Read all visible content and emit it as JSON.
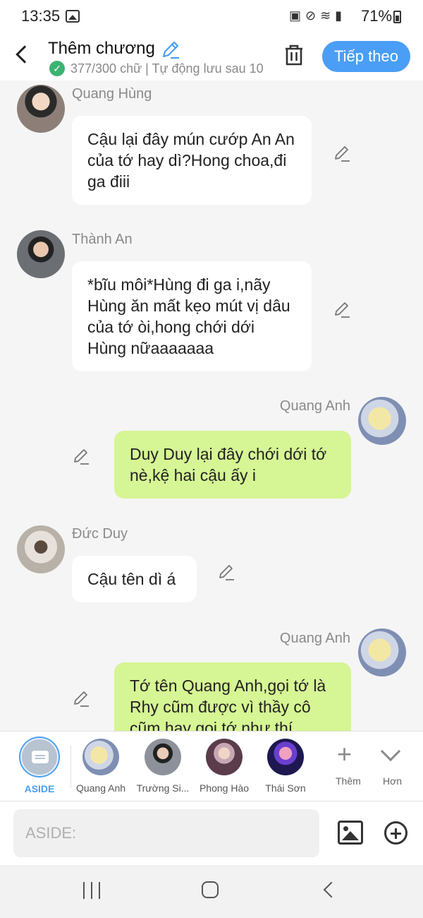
{
  "status_bar": {
    "time": "13:35",
    "battery": "71%"
  },
  "header": {
    "title": "Thêm chương",
    "subtitle": "377/300 chữ | Tự động lưu sau 10",
    "next_button": "Tiếp theo"
  },
  "messages": [
    {
      "speaker": "Quang Hùng",
      "side": "left",
      "text": "Cậu lại đây mún cướp An An của tớ hay dì?Hong choa,đi ga điii"
    },
    {
      "speaker": "Thành An",
      "side": "left",
      "text": "*bĩu môi*Hùng đi ga i,nãy Hùng ăn mất kẹo mút vị dâu của tớ òi,hong chới dới Hùng nữaaaaaaa"
    },
    {
      "speaker": "Quang Anh",
      "side": "right",
      "text": "Duy Duy lại đây chới dới tớ nè,kệ hai cậu ấy i"
    },
    {
      "speaker": "Đức Duy",
      "side": "left",
      "text": "Cậu tên dì á"
    },
    {
      "speaker": "Quang Anh",
      "side": "right",
      "text": "Tớ tên Quang Anh,gọi tớ là Rhy cũm được vì thầy cô cũm hay gọi tớ như thí"
    }
  ],
  "character_bar": {
    "aside_label": "ASIDE",
    "characters": [
      "Quang Anh",
      "Trường Si...",
      "Phong Hào",
      "Thái Sơn"
    ],
    "add_label": "Thêm",
    "more_label": "Hơn"
  },
  "input": {
    "placeholder": "ASIDE:"
  },
  "colors": {
    "accent": "#4a9ef5",
    "right_bubble": "#d6f594",
    "left_bubble": "#ffffff",
    "background": "#f5f5f5"
  }
}
